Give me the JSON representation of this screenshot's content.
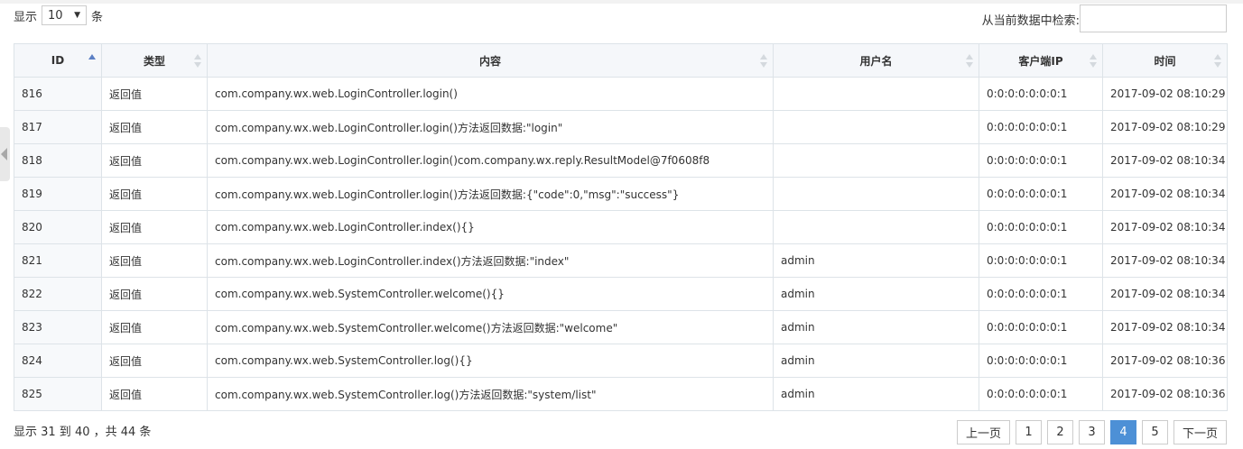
{
  "length_control": {
    "prefix": "显示",
    "value": "10",
    "suffix": "条"
  },
  "search": {
    "label": "从当前数据中检索:",
    "value": ""
  },
  "table": {
    "columns": [
      "ID",
      "类型",
      "内容",
      "用户名",
      "客户端IP",
      "时间"
    ],
    "sorted_column": "ID",
    "sort_direction": "asc",
    "rows": [
      [
        "816",
        "返回值",
        "com.company.wx.web.LoginController.login()",
        "",
        "0:0:0:0:0:0:0:1",
        "2017-09-02 08:10:29"
      ],
      [
        "817",
        "返回值",
        "com.company.wx.web.LoginController.login()方法返回数据:\"login\"",
        "",
        "0:0:0:0:0:0:0:1",
        "2017-09-02 08:10:29"
      ],
      [
        "818",
        "返回值",
        "com.company.wx.web.LoginController.login()com.company.wx.reply.ResultModel@7f0608f8",
        "",
        "0:0:0:0:0:0:0:1",
        "2017-09-02 08:10:34"
      ],
      [
        "819",
        "返回值",
        "com.company.wx.web.LoginController.login()方法返回数据:{\"code\":0,\"msg\":\"success\"}",
        "",
        "0:0:0:0:0:0:0:1",
        "2017-09-02 08:10:34"
      ],
      [
        "820",
        "返回值",
        "com.company.wx.web.LoginController.index(){}",
        "",
        "0:0:0:0:0:0:0:1",
        "2017-09-02 08:10:34"
      ],
      [
        "821",
        "返回值",
        "com.company.wx.web.LoginController.index()方法返回数据:\"index\"",
        "admin",
        "0:0:0:0:0:0:0:1",
        "2017-09-02 08:10:34"
      ],
      [
        "822",
        "返回值",
        "com.company.wx.web.SystemController.welcome(){}",
        "admin",
        "0:0:0:0:0:0:0:1",
        "2017-09-02 08:10:34"
      ],
      [
        "823",
        "返回值",
        "com.company.wx.web.SystemController.welcome()方法返回数据:\"welcome\"",
        "admin",
        "0:0:0:0:0:0:0:1",
        "2017-09-02 08:10:34"
      ],
      [
        "824",
        "返回值",
        "com.company.wx.web.SystemController.log(){}",
        "admin",
        "0:0:0:0:0:0:0:1",
        "2017-09-02 08:10:36"
      ],
      [
        "825",
        "返回值",
        "com.company.wx.web.SystemController.log()方法返回数据:\"system/list\"",
        "admin",
        "0:0:0:0:0:0:0:1",
        "2017-09-02 08:10:36"
      ]
    ]
  },
  "info": "显示 31 到 40 ，共 44 条",
  "pagination": {
    "prev": "上一页",
    "pages": [
      "1",
      "2",
      "3",
      "4",
      "5"
    ],
    "active": "4",
    "next": "下一页"
  },
  "icons": {
    "sort": "sort-arrows-icon",
    "sort_asc": "sort-asc-icon",
    "side_toggle": "chevron-left-icon",
    "dropdown": "caret-down-icon"
  },
  "colors": {
    "accent": "#4d90d6",
    "header_bg": "#f5f7fa",
    "border": "#dde3e8"
  }
}
